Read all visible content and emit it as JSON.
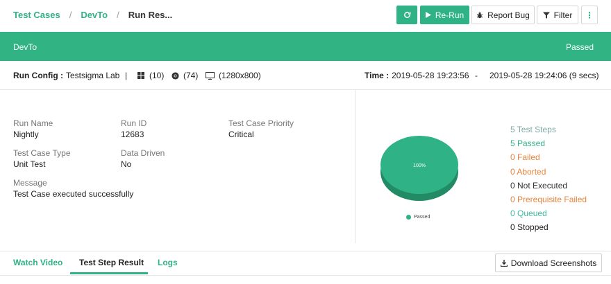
{
  "breadcrumb": {
    "items": [
      "Test Cases",
      "DevTo"
    ],
    "current": "Run Res...",
    "separator": "/"
  },
  "toolbar": {
    "rerun_label": "Re-Run",
    "report_bug_label": "Report Bug",
    "filter_label": "Filter",
    "more_label": "⋮"
  },
  "banner": {
    "name": "DevTo",
    "status": "Passed"
  },
  "run_config": {
    "label": "Run Config :",
    "value": "Testsigma Lab",
    "divider": "|",
    "os_version": "(10)",
    "browser_version": "(74)",
    "resolution": "(1280x800)",
    "time_label": "Time :",
    "start_time": "2019-05-28 19:23:56",
    "dash": "-",
    "end_time": "2019-05-28 19:24:06 (9 secs)"
  },
  "details": {
    "run_name_label": "Run Name",
    "run_name": "Nightly",
    "run_id_label": "Run ID",
    "run_id": "12683",
    "priority_label": "Test Case Priority",
    "priority": "Critical",
    "type_label": "Test Case Type",
    "type": "Unit Test",
    "data_driven_label": "Data Driven",
    "data_driven": "No",
    "message_label": "Message",
    "message": "Test Case executed successfully"
  },
  "chart": {
    "slice_label": "100%",
    "legend": "Passed",
    "passed_fraction": 1.0
  },
  "stats": {
    "total": "5 Test Steps",
    "passed": "5 Passed",
    "failed": "0 Failed",
    "aborted": "0 Aborted",
    "not_executed": "0 Not Executed",
    "prerequisite_failed": "0 Prerequisite Failed",
    "queued": "0 Queued",
    "stopped": "0 Stopped"
  },
  "tabs": {
    "watch_video": "Watch Video",
    "test_step_result": "Test Step Result",
    "logs": "Logs"
  },
  "download_label": "Download Screenshots",
  "colors": {
    "accent": "#2fb286",
    "banner": "#31b384",
    "warning": "#e8833a",
    "muted": "#7fa9a6"
  },
  "icons": {
    "refresh": "refresh-icon",
    "play": "play-icon",
    "bug": "bug-icon",
    "filter": "filter-icon",
    "windows": "windows-icon",
    "chrome": "chrome-icon",
    "monitor": "monitor-icon",
    "download": "download-icon"
  }
}
